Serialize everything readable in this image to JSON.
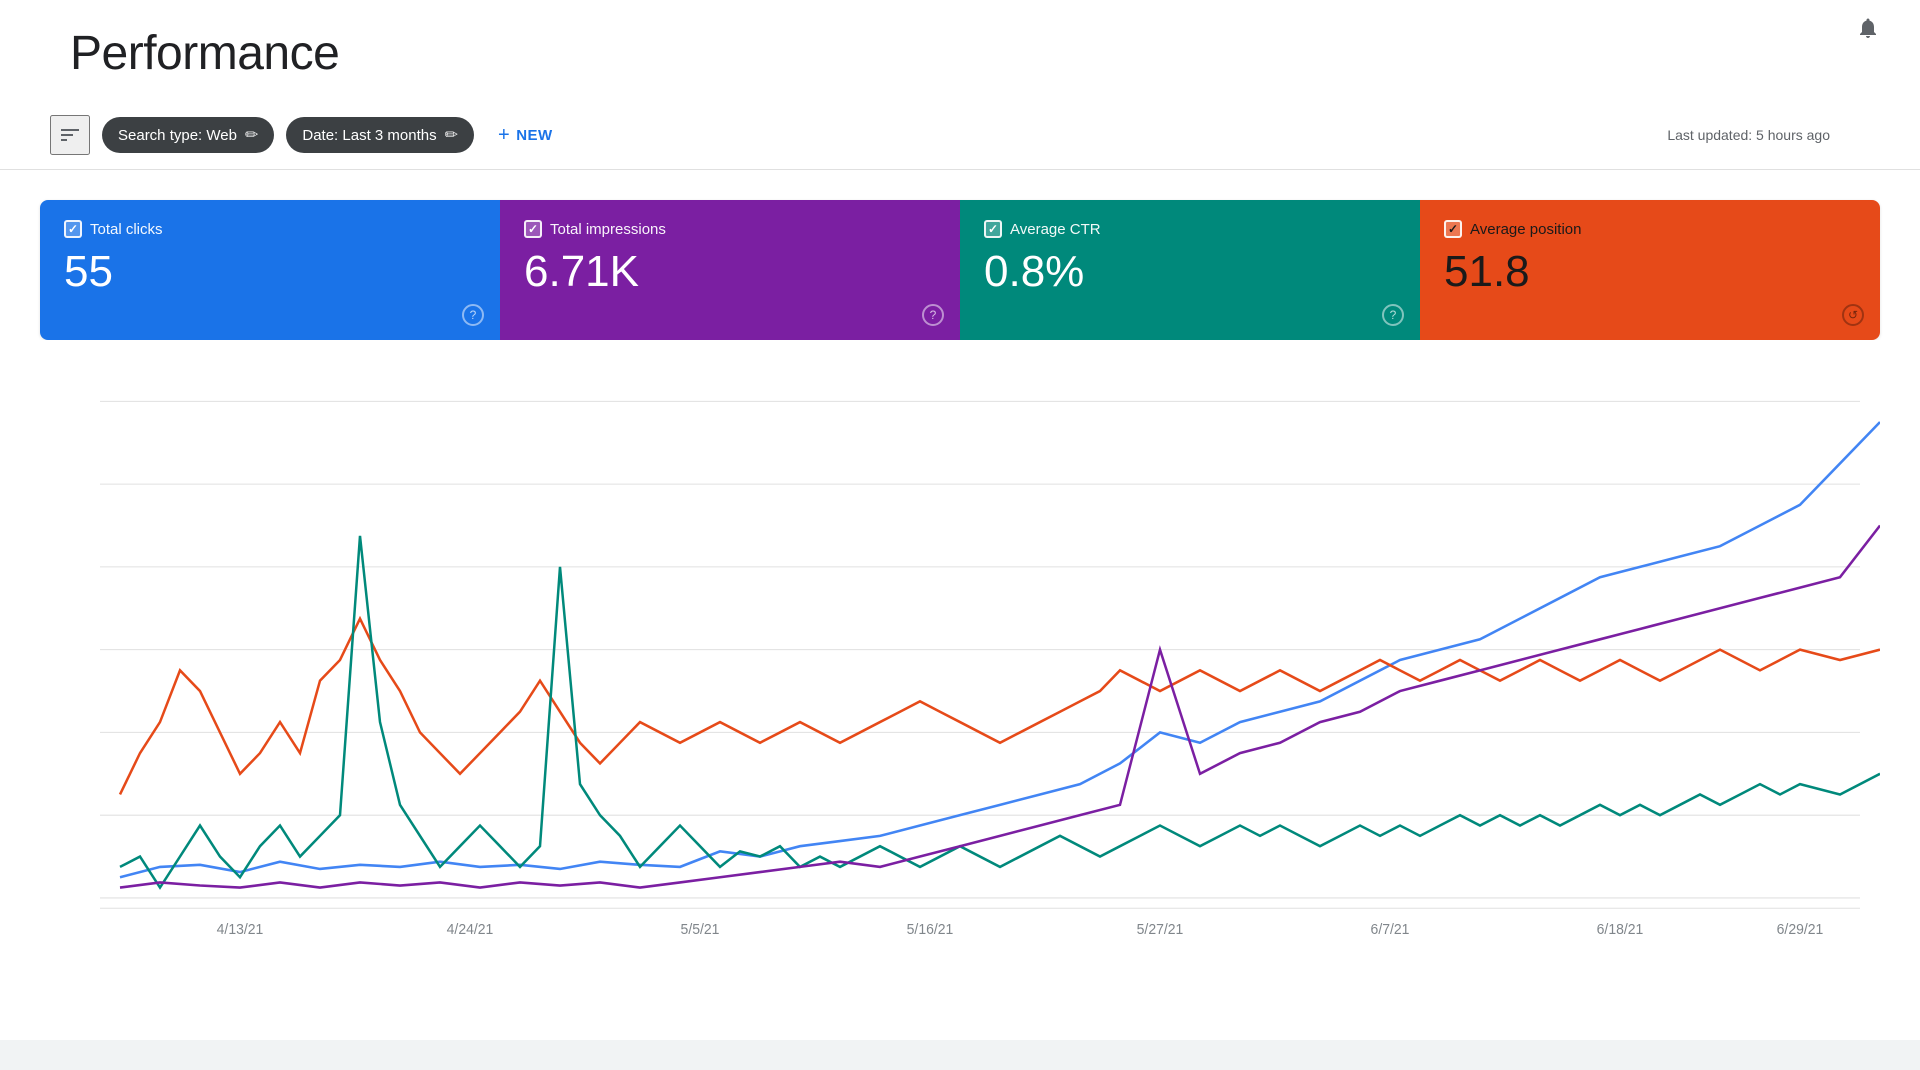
{
  "page": {
    "title": "Performance",
    "notification_icon": "notifications",
    "last_updated": "Last updated: 5 hours ago"
  },
  "toolbar": {
    "filter_icon": "filter-lines",
    "search_type_chip": "Search type: Web",
    "date_chip": "Date: Last 3 months",
    "new_button": "NEW",
    "edit_icon": "✏"
  },
  "metrics": [
    {
      "id": "total-clicks",
      "label": "Total clicks",
      "value": "55",
      "color": "blue",
      "checked": true,
      "info": "?"
    },
    {
      "id": "total-impressions",
      "label": "Total impressions",
      "value": "6.71K",
      "color": "purple",
      "checked": true,
      "info": "?"
    },
    {
      "id": "average-ctr",
      "label": "Average CTR",
      "value": "0.8%",
      "color": "teal",
      "checked": true,
      "info": "?"
    },
    {
      "id": "average-position",
      "label": "Average position",
      "value": "51.8",
      "color": "orange",
      "checked": true,
      "info": "↺"
    }
  ],
  "chart": {
    "x_labels": [
      "4/13/21",
      "4/24/21",
      "5/5/21",
      "5/16/21",
      "5/27/21",
      "6/7/21",
      "6/18/21",
      "6/29/21"
    ],
    "colors": {
      "clicks": "#1a73e8",
      "impressions": "#e64a19",
      "ctr": "#00897b",
      "position": "#7b1fa2"
    }
  }
}
